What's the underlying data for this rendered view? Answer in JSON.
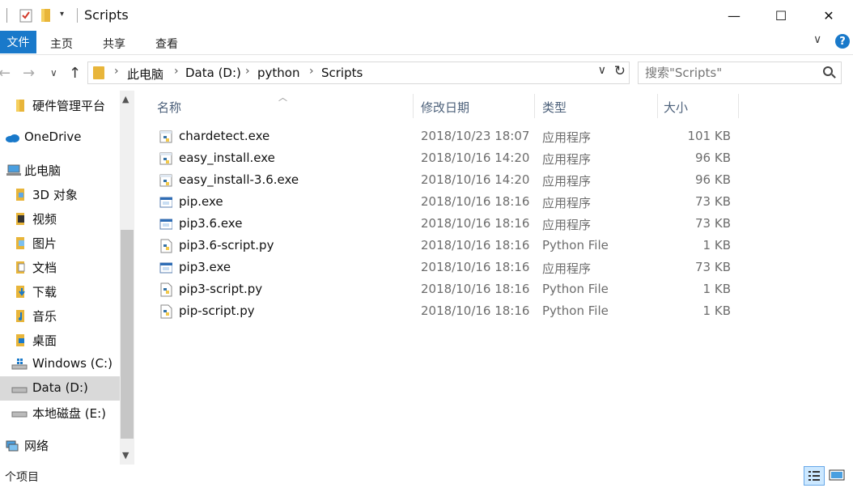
{
  "window": {
    "title": "Scripts",
    "minimize_glyph": "—",
    "maximize_glyph": "☐",
    "close_glyph": "✕"
  },
  "ribbon": {
    "file_tab": "文件",
    "tabs": [
      "主页",
      "共享",
      "查看"
    ],
    "expand_glyph": "∨",
    "help_glyph": "?"
  },
  "address": {
    "crumbs": [
      "此电脑",
      "Data (D:)",
      "python",
      "Scripts"
    ],
    "separator": "›"
  },
  "search": {
    "placeholder": "搜索\"Scripts\""
  },
  "sidebar": {
    "items": [
      {
        "label": "硬件管理平台",
        "icon": "folder-icon"
      },
      {
        "label": "OneDrive",
        "icon": "cloud-icon"
      },
      {
        "label": "此电脑",
        "icon": "computer-icon"
      },
      {
        "label": "3D 对象",
        "icon": "3d-objects-icon"
      },
      {
        "label": "视频",
        "icon": "video-icon"
      },
      {
        "label": "图片",
        "icon": "pictures-icon"
      },
      {
        "label": "文档",
        "icon": "documents-icon"
      },
      {
        "label": "下载",
        "icon": "download-icon"
      },
      {
        "label": "音乐",
        "icon": "music-icon"
      },
      {
        "label": "桌面",
        "icon": "desktop-icon"
      },
      {
        "label": "Windows (C:)",
        "icon": "drive-windows-icon"
      },
      {
        "label": "Data (D:)",
        "icon": "drive-icon"
      },
      {
        "label": "本地磁盘 (E:)",
        "icon": "drive-icon"
      },
      {
        "label": "网络",
        "icon": "network-icon"
      }
    ],
    "selected": "Data (D:)"
  },
  "columns": {
    "name": "名称",
    "date": "修改日期",
    "type": "类型",
    "size": "大小"
  },
  "files": [
    {
      "name": "chardetect.exe",
      "date": "2018/10/23 18:07",
      "type": "应用程序",
      "size": "101 KB",
      "icon": "python-exe-icon"
    },
    {
      "name": "easy_install.exe",
      "date": "2018/10/16 14:20",
      "type": "应用程序",
      "size": "96 KB",
      "icon": "python-exe-icon"
    },
    {
      "name": "easy_install-3.6.exe",
      "date": "2018/10/16 14:20",
      "type": "应用程序",
      "size": "96 KB",
      "icon": "python-exe-icon"
    },
    {
      "name": "pip.exe",
      "date": "2018/10/16 18:16",
      "type": "应用程序",
      "size": "73 KB",
      "icon": "exe-icon"
    },
    {
      "name": "pip3.6.exe",
      "date": "2018/10/16 18:16",
      "type": "应用程序",
      "size": "73 KB",
      "icon": "exe-icon"
    },
    {
      "name": "pip3.6-script.py",
      "date": "2018/10/16 18:16",
      "type": "Python File",
      "size": "1 KB",
      "icon": "python-file-icon"
    },
    {
      "name": "pip3.exe",
      "date": "2018/10/16 18:16",
      "type": "应用程序",
      "size": "73 KB",
      "icon": "exe-icon"
    },
    {
      "name": "pip3-script.py",
      "date": "2018/10/16 18:16",
      "type": "Python File",
      "size": "1 KB",
      "icon": "python-file-icon"
    },
    {
      "name": "pip-script.py",
      "date": "2018/10/16 18:16",
      "type": "Python File",
      "size": "1 KB",
      "icon": "python-file-icon"
    }
  ],
  "status": {
    "item_count": "个项目"
  },
  "colors": {
    "accent": "#1979ca",
    "selection": "#cce8ff",
    "folder": "#e8b53a"
  }
}
